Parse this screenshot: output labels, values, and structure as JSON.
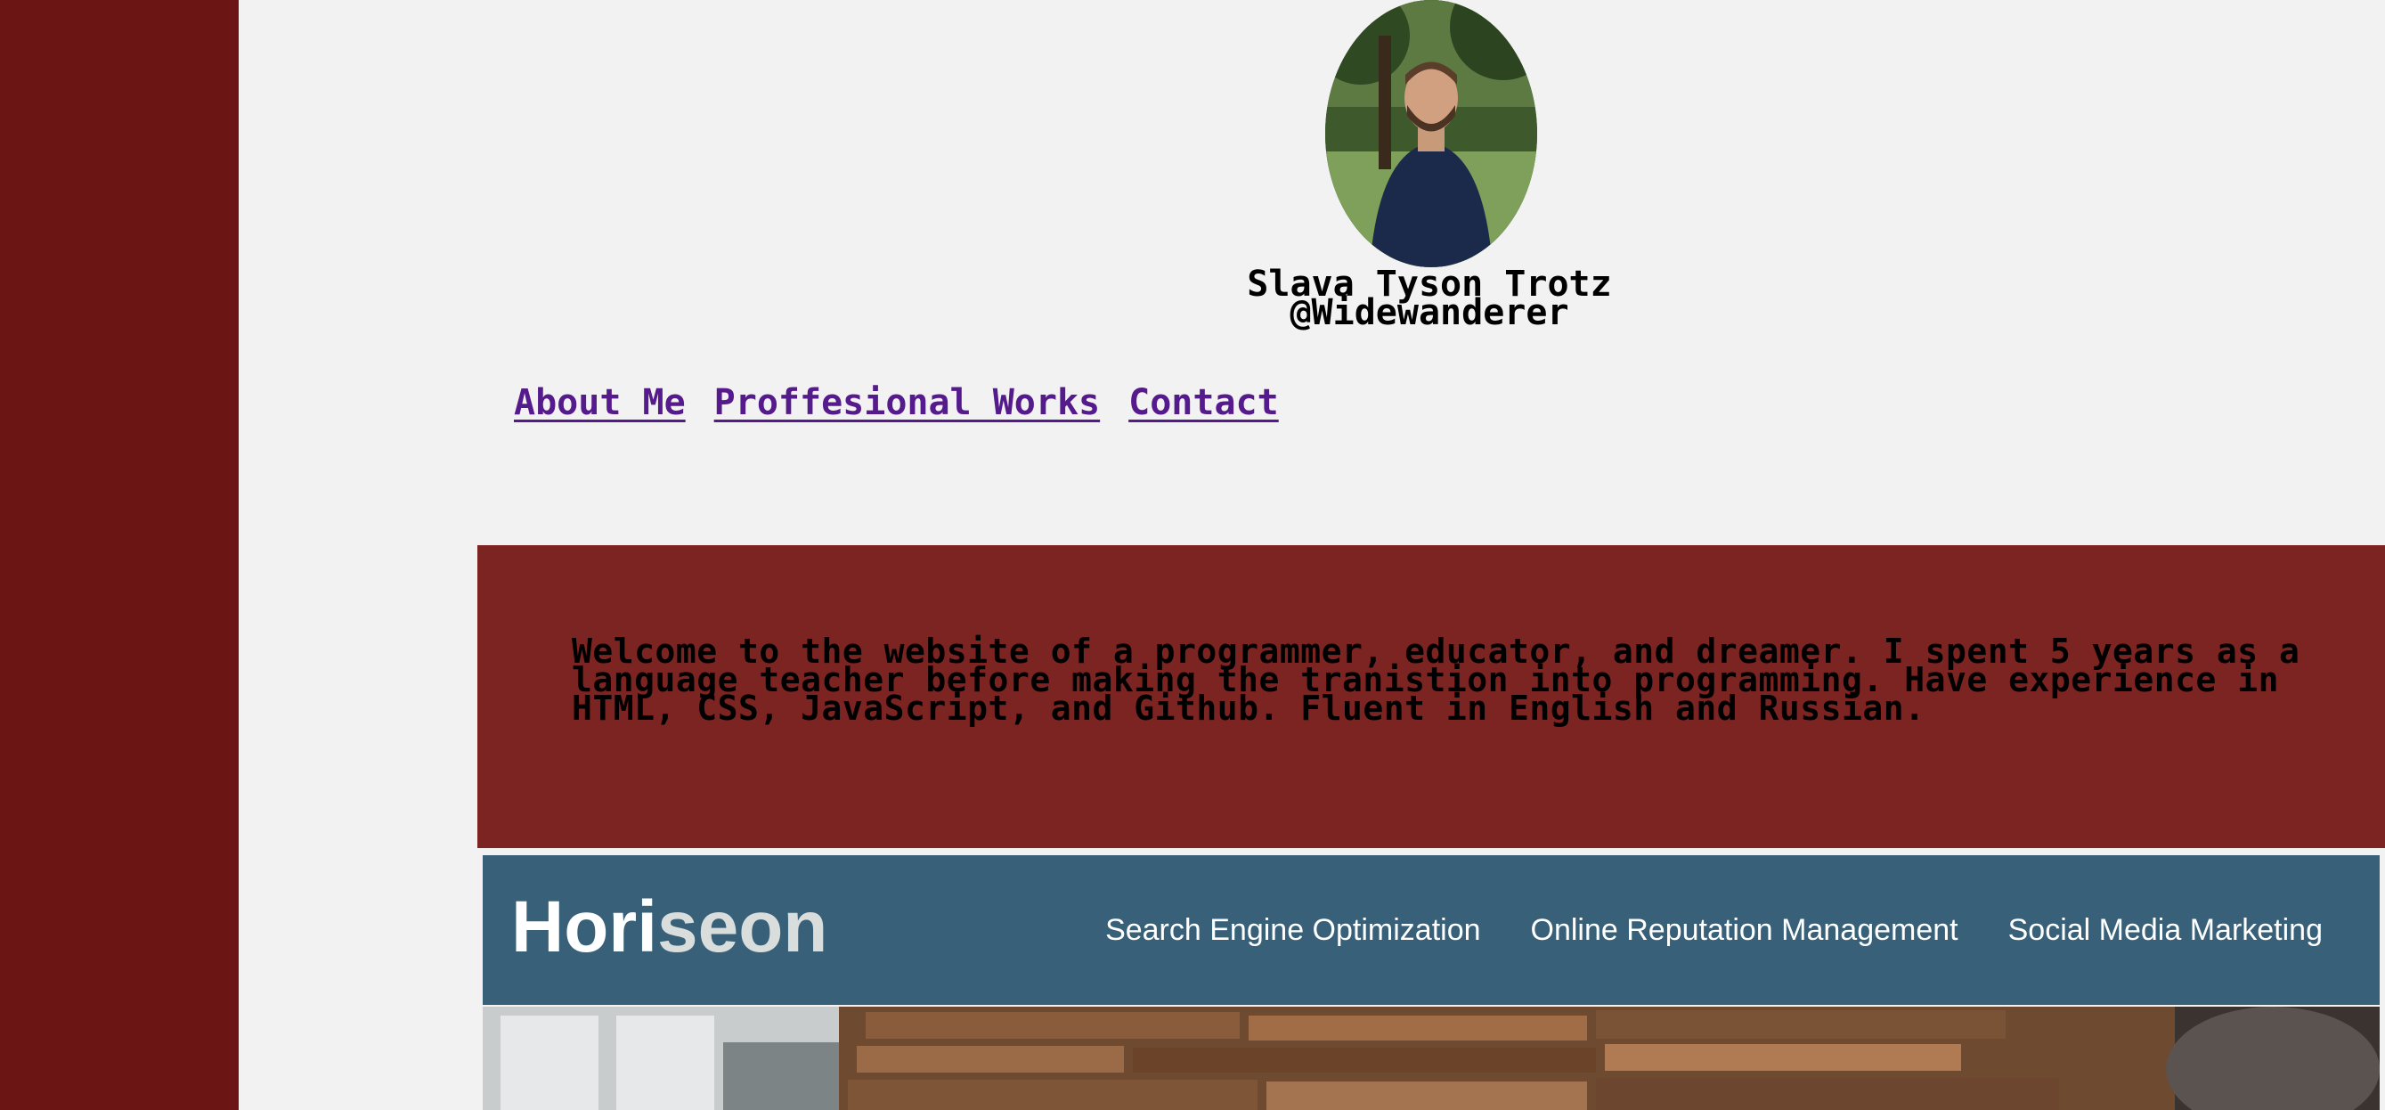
{
  "profile": {
    "name": "Slava Tyson Trotz",
    "handle": "@Widewanderer"
  },
  "nav": {
    "items": [
      "About Me",
      "Proffesional Works",
      "Contact"
    ]
  },
  "welcome": {
    "text": "Welcome to the website of a programmer, educator, and dreamer. I spent 5 years as a language teacher before making the tranistion into programming. Have experience in HTML, CSS, JavaScript, and Github. Fluent in English and Russian."
  },
  "horiseon": {
    "logo_main": "Hori",
    "logo_accent": "seon",
    "nav": [
      "Search Engine Optimization",
      "Online Reputation Management",
      "Social Media Marketing"
    ]
  },
  "colors": {
    "sidebar": "#6b1614",
    "welcome_bg": "#7b2421",
    "page_bg": "#f2f2f2",
    "link": "#551a8b",
    "horiseon_header": "#386078"
  }
}
